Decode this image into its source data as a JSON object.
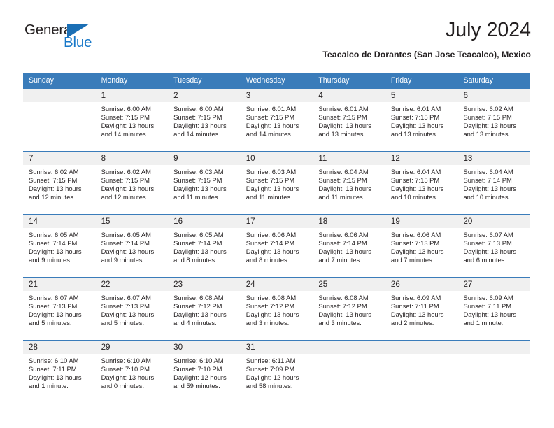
{
  "brand": {
    "name_part1": "General",
    "name_part2": "Blue",
    "triangle_icon": "triangle-icon",
    "color_dark": "#231f20",
    "color_blue": "#1878c8"
  },
  "header": {
    "month_title": "July 2024",
    "location": "Teacalco de Dorantes (San Jose Teacalco), Mexico"
  },
  "theme": {
    "header_blue": "#3a7cba",
    "daynum_row_gray": "#f0f0f0",
    "text": "#231f20"
  },
  "weekday_headers": [
    "Sunday",
    "Monday",
    "Tuesday",
    "Wednesday",
    "Thursday",
    "Friday",
    "Saturday"
  ],
  "weeks": [
    {
      "days": [
        {
          "num": "",
          "sunrise": "",
          "sunset": "",
          "daylight_line1": "",
          "daylight_line2": ""
        },
        {
          "num": "1",
          "sunrise": "Sunrise: 6:00 AM",
          "sunset": "Sunset: 7:15 PM",
          "daylight_line1": "Daylight: 13 hours",
          "daylight_line2": "and 14 minutes."
        },
        {
          "num": "2",
          "sunrise": "Sunrise: 6:00 AM",
          "sunset": "Sunset: 7:15 PM",
          "daylight_line1": "Daylight: 13 hours",
          "daylight_line2": "and 14 minutes."
        },
        {
          "num": "3",
          "sunrise": "Sunrise: 6:01 AM",
          "sunset": "Sunset: 7:15 PM",
          "daylight_line1": "Daylight: 13 hours",
          "daylight_line2": "and 14 minutes."
        },
        {
          "num": "4",
          "sunrise": "Sunrise: 6:01 AM",
          "sunset": "Sunset: 7:15 PM",
          "daylight_line1": "Daylight: 13 hours",
          "daylight_line2": "and 13 minutes."
        },
        {
          "num": "5",
          "sunrise": "Sunrise: 6:01 AM",
          "sunset": "Sunset: 7:15 PM",
          "daylight_line1": "Daylight: 13 hours",
          "daylight_line2": "and 13 minutes."
        },
        {
          "num": "6",
          "sunrise": "Sunrise: 6:02 AM",
          "sunset": "Sunset: 7:15 PM",
          "daylight_line1": "Daylight: 13 hours",
          "daylight_line2": "and 13 minutes."
        }
      ]
    },
    {
      "days": [
        {
          "num": "7",
          "sunrise": "Sunrise: 6:02 AM",
          "sunset": "Sunset: 7:15 PM",
          "daylight_line1": "Daylight: 13 hours",
          "daylight_line2": "and 12 minutes."
        },
        {
          "num": "8",
          "sunrise": "Sunrise: 6:02 AM",
          "sunset": "Sunset: 7:15 PM",
          "daylight_line1": "Daylight: 13 hours",
          "daylight_line2": "and 12 minutes."
        },
        {
          "num": "9",
          "sunrise": "Sunrise: 6:03 AM",
          "sunset": "Sunset: 7:15 PM",
          "daylight_line1": "Daylight: 13 hours",
          "daylight_line2": "and 11 minutes."
        },
        {
          "num": "10",
          "sunrise": "Sunrise: 6:03 AM",
          "sunset": "Sunset: 7:15 PM",
          "daylight_line1": "Daylight: 13 hours",
          "daylight_line2": "and 11 minutes."
        },
        {
          "num": "11",
          "sunrise": "Sunrise: 6:04 AM",
          "sunset": "Sunset: 7:15 PM",
          "daylight_line1": "Daylight: 13 hours",
          "daylight_line2": "and 11 minutes."
        },
        {
          "num": "12",
          "sunrise": "Sunrise: 6:04 AM",
          "sunset": "Sunset: 7:15 PM",
          "daylight_line1": "Daylight: 13 hours",
          "daylight_line2": "and 10 minutes."
        },
        {
          "num": "13",
          "sunrise": "Sunrise: 6:04 AM",
          "sunset": "Sunset: 7:14 PM",
          "daylight_line1": "Daylight: 13 hours",
          "daylight_line2": "and 10 minutes."
        }
      ]
    },
    {
      "days": [
        {
          "num": "14",
          "sunrise": "Sunrise: 6:05 AM",
          "sunset": "Sunset: 7:14 PM",
          "daylight_line1": "Daylight: 13 hours",
          "daylight_line2": "and 9 minutes."
        },
        {
          "num": "15",
          "sunrise": "Sunrise: 6:05 AM",
          "sunset": "Sunset: 7:14 PM",
          "daylight_line1": "Daylight: 13 hours",
          "daylight_line2": "and 9 minutes."
        },
        {
          "num": "16",
          "sunrise": "Sunrise: 6:05 AM",
          "sunset": "Sunset: 7:14 PM",
          "daylight_line1": "Daylight: 13 hours",
          "daylight_line2": "and 8 minutes."
        },
        {
          "num": "17",
          "sunrise": "Sunrise: 6:06 AM",
          "sunset": "Sunset: 7:14 PM",
          "daylight_line1": "Daylight: 13 hours",
          "daylight_line2": "and 8 minutes."
        },
        {
          "num": "18",
          "sunrise": "Sunrise: 6:06 AM",
          "sunset": "Sunset: 7:14 PM",
          "daylight_line1": "Daylight: 13 hours",
          "daylight_line2": "and 7 minutes."
        },
        {
          "num": "19",
          "sunrise": "Sunrise: 6:06 AM",
          "sunset": "Sunset: 7:13 PM",
          "daylight_line1": "Daylight: 13 hours",
          "daylight_line2": "and 7 minutes."
        },
        {
          "num": "20",
          "sunrise": "Sunrise: 6:07 AM",
          "sunset": "Sunset: 7:13 PM",
          "daylight_line1": "Daylight: 13 hours",
          "daylight_line2": "and 6 minutes."
        }
      ]
    },
    {
      "days": [
        {
          "num": "21",
          "sunrise": "Sunrise: 6:07 AM",
          "sunset": "Sunset: 7:13 PM",
          "daylight_line1": "Daylight: 13 hours",
          "daylight_line2": "and 5 minutes."
        },
        {
          "num": "22",
          "sunrise": "Sunrise: 6:07 AM",
          "sunset": "Sunset: 7:13 PM",
          "daylight_line1": "Daylight: 13 hours",
          "daylight_line2": "and 5 minutes."
        },
        {
          "num": "23",
          "sunrise": "Sunrise: 6:08 AM",
          "sunset": "Sunset: 7:12 PM",
          "daylight_line1": "Daylight: 13 hours",
          "daylight_line2": "and 4 minutes."
        },
        {
          "num": "24",
          "sunrise": "Sunrise: 6:08 AM",
          "sunset": "Sunset: 7:12 PM",
          "daylight_line1": "Daylight: 13 hours",
          "daylight_line2": "and 3 minutes."
        },
        {
          "num": "25",
          "sunrise": "Sunrise: 6:08 AM",
          "sunset": "Sunset: 7:12 PM",
          "daylight_line1": "Daylight: 13 hours",
          "daylight_line2": "and 3 minutes."
        },
        {
          "num": "26",
          "sunrise": "Sunrise: 6:09 AM",
          "sunset": "Sunset: 7:11 PM",
          "daylight_line1": "Daylight: 13 hours",
          "daylight_line2": "and 2 minutes."
        },
        {
          "num": "27",
          "sunrise": "Sunrise: 6:09 AM",
          "sunset": "Sunset: 7:11 PM",
          "daylight_line1": "Daylight: 13 hours",
          "daylight_line2": "and 1 minute."
        }
      ]
    },
    {
      "days": [
        {
          "num": "28",
          "sunrise": "Sunrise: 6:10 AM",
          "sunset": "Sunset: 7:11 PM",
          "daylight_line1": "Daylight: 13 hours",
          "daylight_line2": "and 1 minute."
        },
        {
          "num": "29",
          "sunrise": "Sunrise: 6:10 AM",
          "sunset": "Sunset: 7:10 PM",
          "daylight_line1": "Daylight: 13 hours",
          "daylight_line2": "and 0 minutes."
        },
        {
          "num": "30",
          "sunrise": "Sunrise: 6:10 AM",
          "sunset": "Sunset: 7:10 PM",
          "daylight_line1": "Daylight: 12 hours",
          "daylight_line2": "and 59 minutes."
        },
        {
          "num": "31",
          "sunrise": "Sunrise: 6:11 AM",
          "sunset": "Sunset: 7:09 PM",
          "daylight_line1": "Daylight: 12 hours",
          "daylight_line2": "and 58 minutes."
        },
        {
          "num": "",
          "sunrise": "",
          "sunset": "",
          "daylight_line1": "",
          "daylight_line2": ""
        },
        {
          "num": "",
          "sunrise": "",
          "sunset": "",
          "daylight_line1": "",
          "daylight_line2": ""
        },
        {
          "num": "",
          "sunrise": "",
          "sunset": "",
          "daylight_line1": "",
          "daylight_line2": ""
        }
      ]
    }
  ]
}
